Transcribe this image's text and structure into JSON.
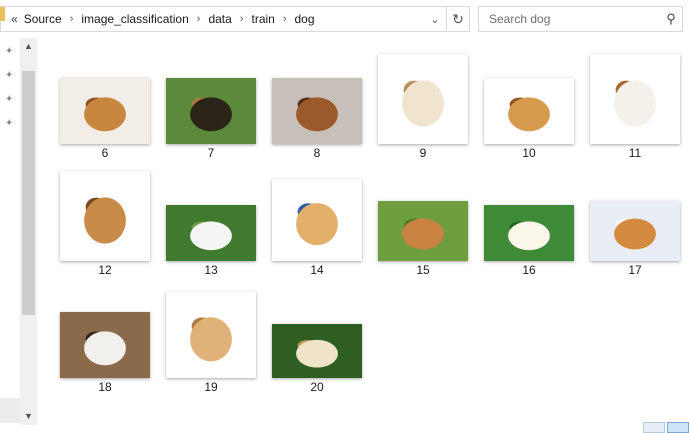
{
  "address_bar": {
    "overflow_label": "«",
    "crumbs": [
      "Source",
      "image_classification",
      "data",
      "train",
      "dog"
    ],
    "separator": "›",
    "dropdown_icon": "chevron-down-icon",
    "refresh_icon": "refresh-icon"
  },
  "search": {
    "placeholder": "Search dog",
    "value": "",
    "icon": "search-icon"
  },
  "files": [
    {
      "name": "6",
      "w": 90,
      "h": 66,
      "colors": [
        "#f2ede6",
        "#c8863e",
        "#8a4f1c"
      ]
    },
    {
      "name": "7",
      "w": 90,
      "h": 66,
      "colors": [
        "#5c8a3a",
        "#2b2418",
        "#b07a3c"
      ]
    },
    {
      "name": "8",
      "w": 90,
      "h": 66,
      "colors": [
        "#c7c0b8",
        "#9a5a2c",
        "#4e2e17"
      ]
    },
    {
      "name": "9",
      "w": 90,
      "h": 90,
      "colors": [
        "#ffffff",
        "#f1e4cf",
        "#b98f5c"
      ]
    },
    {
      "name": "10",
      "w": 90,
      "h": 66,
      "colors": [
        "#ffffff",
        "#d89a4c",
        "#8a5320"
      ]
    },
    {
      "name": "11",
      "w": 90,
      "h": 90,
      "colors": [
        "#ffffff",
        "#f4f0ea",
        "#a9672f"
      ]
    },
    {
      "name": "12",
      "w": 90,
      "h": 90,
      "colors": [
        "#ffffff",
        "#c98b4a",
        "#7a4b22"
      ]
    },
    {
      "name": "13",
      "w": 90,
      "h": 56,
      "colors": [
        "#3f7a2f",
        "#f5f5f3",
        "#6ba24a"
      ]
    },
    {
      "name": "14",
      "w": 90,
      "h": 82,
      "colors": [
        "#ffffff",
        "#e2b06a",
        "#2f5fa8"
      ]
    },
    {
      "name": "15",
      "w": 90,
      "h": 60,
      "colors": [
        "#6f9e3e",
        "#c98242",
        "#4f7d29"
      ]
    },
    {
      "name": "16",
      "w": 90,
      "h": 56,
      "colors": [
        "#3e8a36",
        "#fbf6ea",
        "#25601f"
      ]
    },
    {
      "name": "17",
      "w": 90,
      "h": 60,
      "colors": [
        "#e9eef6",
        "#d38a3e",
        "#f7f9fc"
      ]
    },
    {
      "name": "18",
      "w": 90,
      "h": 66,
      "colors": [
        "#8a6a4a",
        "#f2f0ec",
        "#3a2418"
      ]
    },
    {
      "name": "19",
      "w": 90,
      "h": 86,
      "colors": [
        "#ffffff",
        "#e0b27a",
        "#b07a40"
      ]
    },
    {
      "name": "20",
      "w": 90,
      "h": 54,
      "colors": [
        "#2f5e22",
        "#f0e4c8",
        "#c79a5a"
      ]
    }
  ],
  "nav_pins": [
    "pin-icon",
    "pin-icon",
    "pin-icon",
    "pin-icon"
  ],
  "scrollbar": {
    "up_icon": "chevron-up-icon",
    "down_icon": "chevron-down-icon"
  },
  "view_buttons": [
    "details-view-icon",
    "large-icons-view-icon"
  ]
}
